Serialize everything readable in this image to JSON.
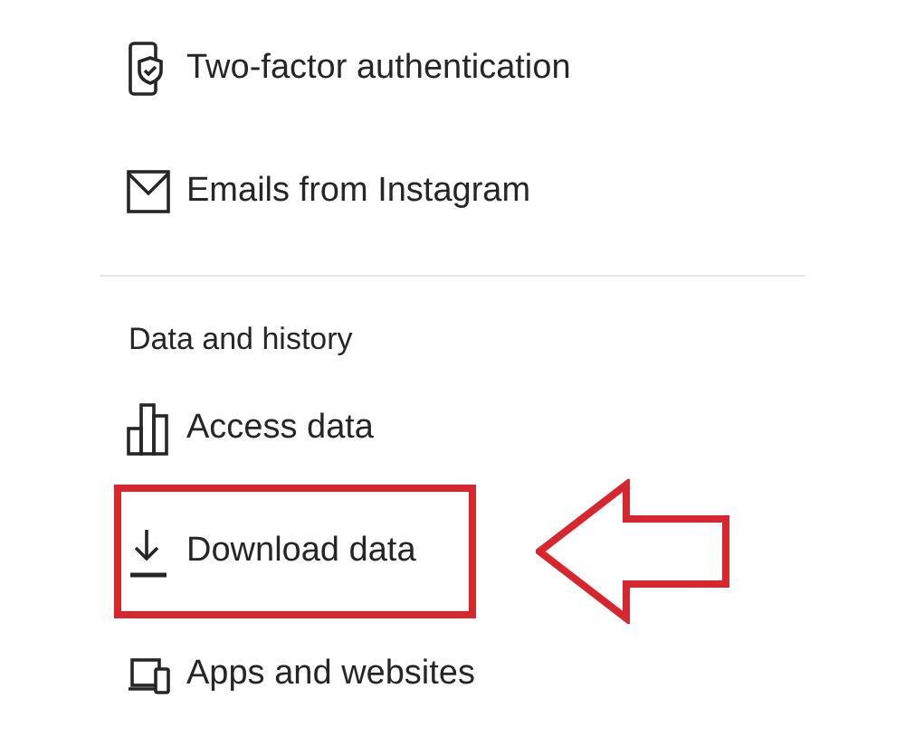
{
  "groups": [
    {
      "items": [
        {
          "kind": "two-factor",
          "label": "Two-factor authentication",
          "highlighted": false
        },
        {
          "kind": "email",
          "label": "Emails from Instagram",
          "highlighted": false
        }
      ]
    },
    {
      "title": "Data and history",
      "items": [
        {
          "kind": "access",
          "label": "Access data",
          "highlighted": false
        },
        {
          "kind": "download",
          "label": "Download data",
          "highlighted": true
        },
        {
          "kind": "apps",
          "label": "Apps and websites",
          "highlighted": false
        }
      ]
    }
  ]
}
